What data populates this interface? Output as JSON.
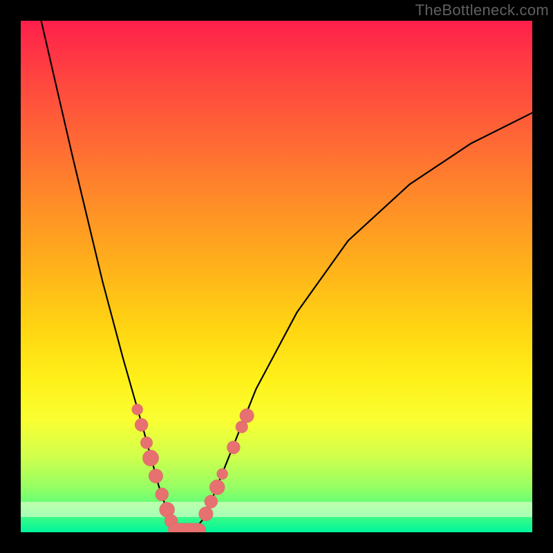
{
  "watermark": "TheBottleneck.com",
  "colors": {
    "frame": "#000000",
    "marker": "#e77070",
    "gradient_top": "#ff1f4b",
    "gradient_bottom": "#00f59b"
  },
  "chart_data": {
    "type": "line",
    "title": "",
    "xlabel": "",
    "ylabel": "",
    "xlim": [
      0,
      100
    ],
    "ylim": [
      0,
      100
    ],
    "curve": [
      {
        "x": 4,
        "y": 100
      },
      {
        "x": 10,
        "y": 74
      },
      {
        "x": 16,
        "y": 49
      },
      {
        "x": 20,
        "y": 34
      },
      {
        "x": 24,
        "y": 20
      },
      {
        "x": 27,
        "y": 9
      },
      {
        "x": 29,
        "y": 3
      },
      {
        "x": 30,
        "y": 0.5
      },
      {
        "x": 32,
        "y": 0
      },
      {
        "x": 34,
        "y": 0.5
      },
      {
        "x": 36,
        "y": 3
      },
      {
        "x": 40,
        "y": 13
      },
      {
        "x": 46,
        "y": 28
      },
      {
        "x": 54,
        "y": 43
      },
      {
        "x": 64,
        "y": 57
      },
      {
        "x": 76,
        "y": 68
      },
      {
        "x": 88,
        "y": 76
      },
      {
        "x": 100,
        "y": 82
      }
    ],
    "left_markers": [
      {
        "x": 22.8,
        "y": 24.0,
        "r": 1.1
      },
      {
        "x": 23.6,
        "y": 21.0,
        "r": 1.3
      },
      {
        "x": 24.6,
        "y": 17.5,
        "r": 1.2
      },
      {
        "x": 25.4,
        "y": 14.5,
        "r": 1.6
      },
      {
        "x": 26.4,
        "y": 11.0,
        "r": 1.4
      },
      {
        "x": 27.6,
        "y": 7.4,
        "r": 1.3
      },
      {
        "x": 28.6,
        "y": 4.4,
        "r": 1.5
      },
      {
        "x": 29.4,
        "y": 2.2,
        "r": 1.3
      }
    ],
    "right_markers": [
      {
        "x": 36.2,
        "y": 3.6,
        "r": 1.4
      },
      {
        "x": 37.2,
        "y": 6.0,
        "r": 1.3
      },
      {
        "x": 38.4,
        "y": 8.8,
        "r": 1.5
      },
      {
        "x": 39.4,
        "y": 11.4,
        "r": 1.1
      },
      {
        "x": 41.6,
        "y": 16.6,
        "r": 1.3
      },
      {
        "x": 43.2,
        "y": 20.6,
        "r": 1.2
      },
      {
        "x": 44.2,
        "y": 22.8,
        "r": 1.4
      }
    ],
    "bottom_pill": {
      "x0": 30.2,
      "x1": 34.8,
      "y": 0.4,
      "r": 1.4
    }
  }
}
